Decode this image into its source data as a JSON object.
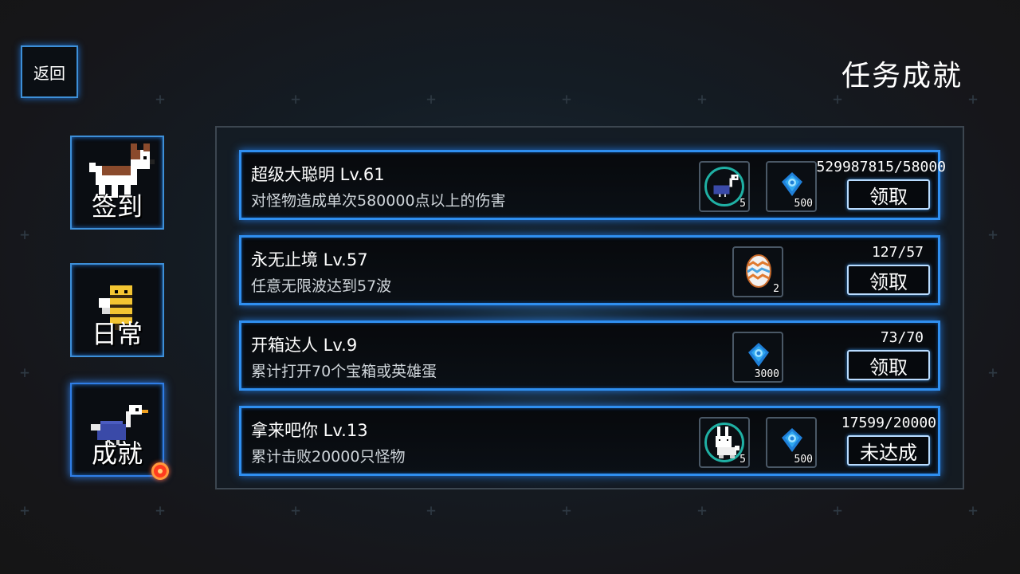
{
  "header": {
    "back_label": "返回",
    "title": "任务成就"
  },
  "sidebar": {
    "items": [
      {
        "label": "签到",
        "icon": "dog-icon"
      },
      {
        "label": "日常",
        "icon": "bee-icon"
      },
      {
        "label": "成就",
        "icon": "ostrich-icon",
        "active": true,
        "has_notification": true
      }
    ]
  },
  "tasks": [
    {
      "name": "超级大聪明 Lv.61",
      "desc": "对怪物造成单次580000点以上的伤害",
      "progress": "529987815/58000",
      "rewards": [
        {
          "icon": "ostrich-icon",
          "qty": "5"
        },
        {
          "icon": "crystal-icon",
          "qty": "500"
        }
      ],
      "action": "领取"
    },
    {
      "name": "永无止境 Lv.57",
      "desc": "任意无限波达到57波",
      "progress": "127/57",
      "rewards": [
        {
          "icon": "egg-icon",
          "qty": "2"
        }
      ],
      "action": "领取"
    },
    {
      "name": "开箱达人 Lv.9",
      "desc": "累计打开70个宝箱或英雄蛋",
      "progress": "73/70",
      "rewards": [
        {
          "icon": "crystal-icon",
          "qty": "3000"
        }
      ],
      "action": "领取"
    },
    {
      "name": "拿来吧你 Lv.13",
      "desc": "累计击败20000只怪物",
      "progress": "17599/20000",
      "rewards": [
        {
          "icon": "rabbit-icon",
          "qty": "5"
        },
        {
          "icon": "crystal-icon",
          "qty": "500"
        }
      ],
      "action": "未达成"
    }
  ],
  "colors": {
    "accent": "#2f8ff0",
    "badge": "#ff3b1f",
    "ring": "#1fb0a4"
  }
}
